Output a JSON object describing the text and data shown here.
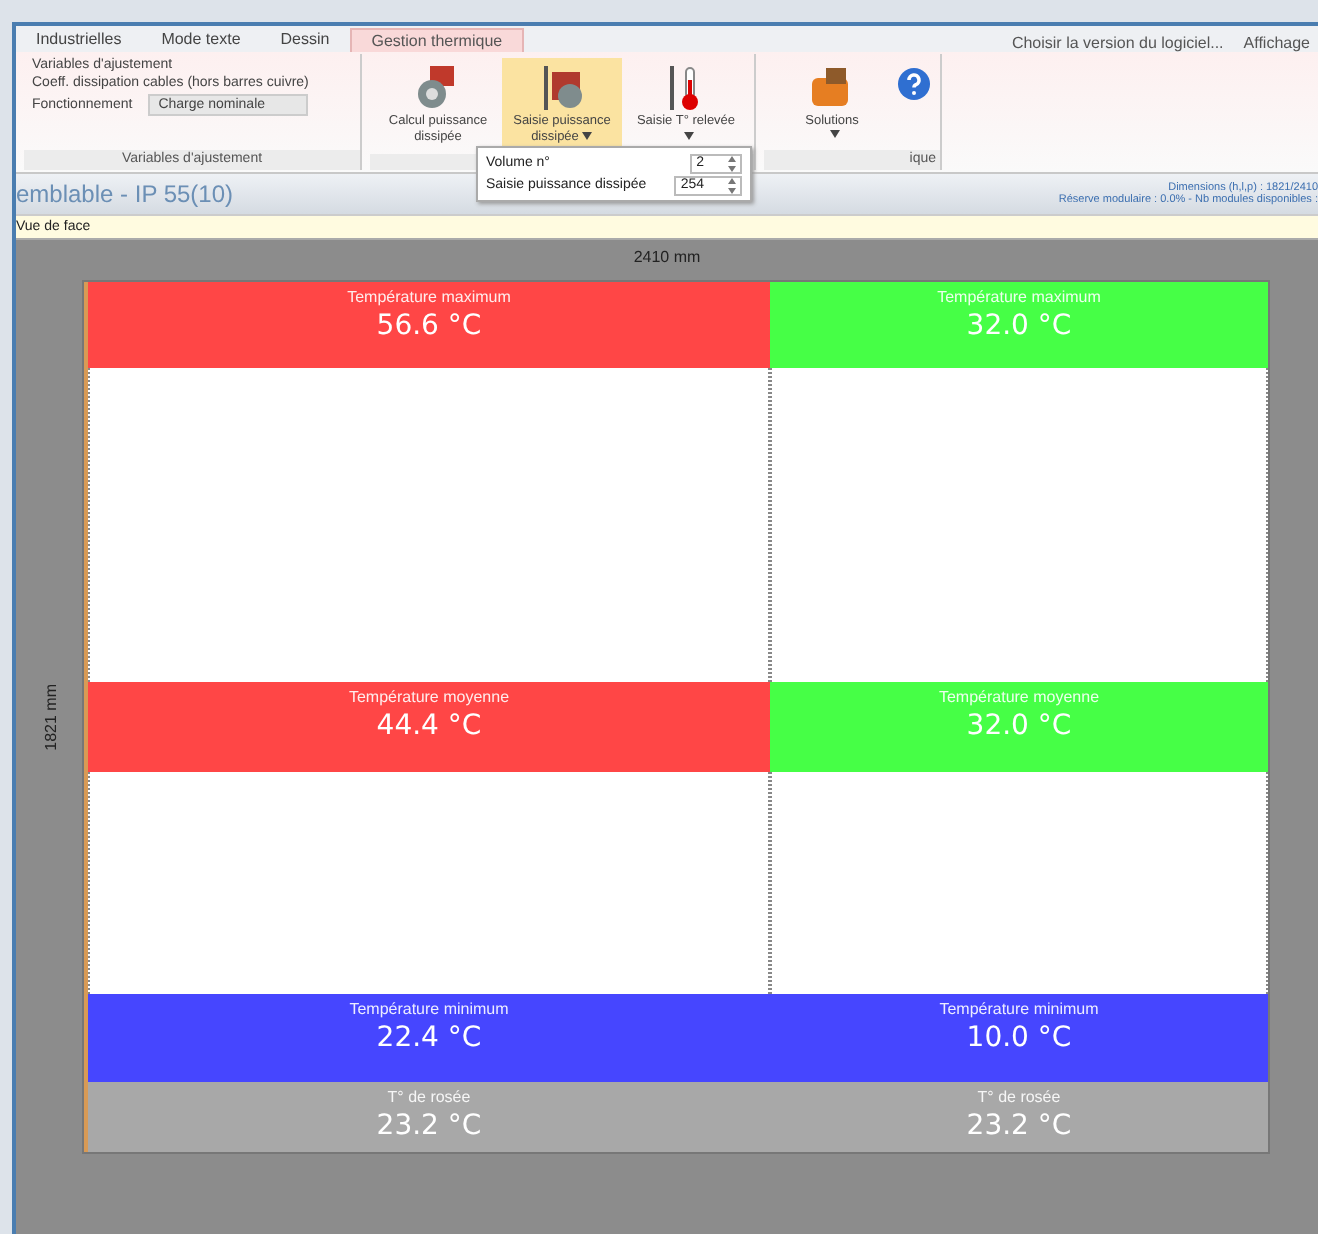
{
  "menu_right": [
    "Choisir la version du logiciel...",
    "Affichage"
  ],
  "tabs": [
    {
      "label": "Industrielles",
      "selected": false
    },
    {
      "label": "Mode texte",
      "selected": false
    },
    {
      "label": "Dessin",
      "selected": false
    },
    {
      "label": "Gestion thermique",
      "selected": true
    }
  ],
  "ribbon": {
    "dropdowns": [
      "Variables d'ajustement",
      "Coeff. dissipation cables (hors barres cuivre)"
    ],
    "operation": {
      "label": "Fonctionnement",
      "value": "Charge nominale"
    },
    "group_label": "Variables d'ajustement",
    "buttons": [
      {
        "label": "Calcul puissance dissipée",
        "selected": false,
        "dropdown": false
      },
      {
        "label": "Saisie puissance dissipée",
        "selected": true,
        "dropdown": true
      },
      {
        "label": "Saisie T° relevée",
        "selected": false,
        "dropdown": true
      }
    ],
    "solutions": "Solutions",
    "group_label_2": "ique"
  },
  "popup": [
    {
      "label": "Volume n°",
      "value": "2"
    },
    {
      "label": "Saisie puissance dissipée",
      "value": "254"
    }
  ],
  "title": "emblable - IP 55(10)",
  "status": [
    "Dimensions (h,l,p) : 1821/2410",
    "Réserve modulaire : 0.0% - Nb modules disponibles :"
  ],
  "view_label": "Vue de face",
  "width_label": "2410 mm",
  "height_label": "1821 mm",
  "zones": [
    {
      "bands": [
        {
          "kind": "band",
          "label": "Température maximum",
          "value": "56.6 °C",
          "color": "#ff4646"
        },
        {
          "kind": "gap"
        },
        {
          "kind": "band",
          "label": "Température moyenne",
          "value": "44.4 °C",
          "color": "#ff4646"
        },
        {
          "kind": "gap"
        },
        {
          "kind": "band",
          "label": "Température minimum",
          "value": "22.4 °C",
          "color": "#4646ff"
        },
        {
          "kind": "band",
          "label": "T° de rosée",
          "value": "23.2 °C",
          "color": "#a8a8a8"
        }
      ]
    },
    {
      "bands": [
        {
          "kind": "band",
          "label": "Température maximum",
          "value": "32.0 °C",
          "color": "#46ff46"
        },
        {
          "kind": "gap"
        },
        {
          "kind": "band",
          "label": "Température moyenne",
          "value": "32.0 °C",
          "color": "#46ff46"
        },
        {
          "kind": "gap"
        },
        {
          "kind": "band",
          "label": "Température minimum",
          "value": "10.0 °C",
          "color": "#4646ff"
        },
        {
          "kind": "band",
          "label": "T° de rosée",
          "value": "23.2 °C",
          "color": "#a8a8a8"
        }
      ]
    }
  ]
}
